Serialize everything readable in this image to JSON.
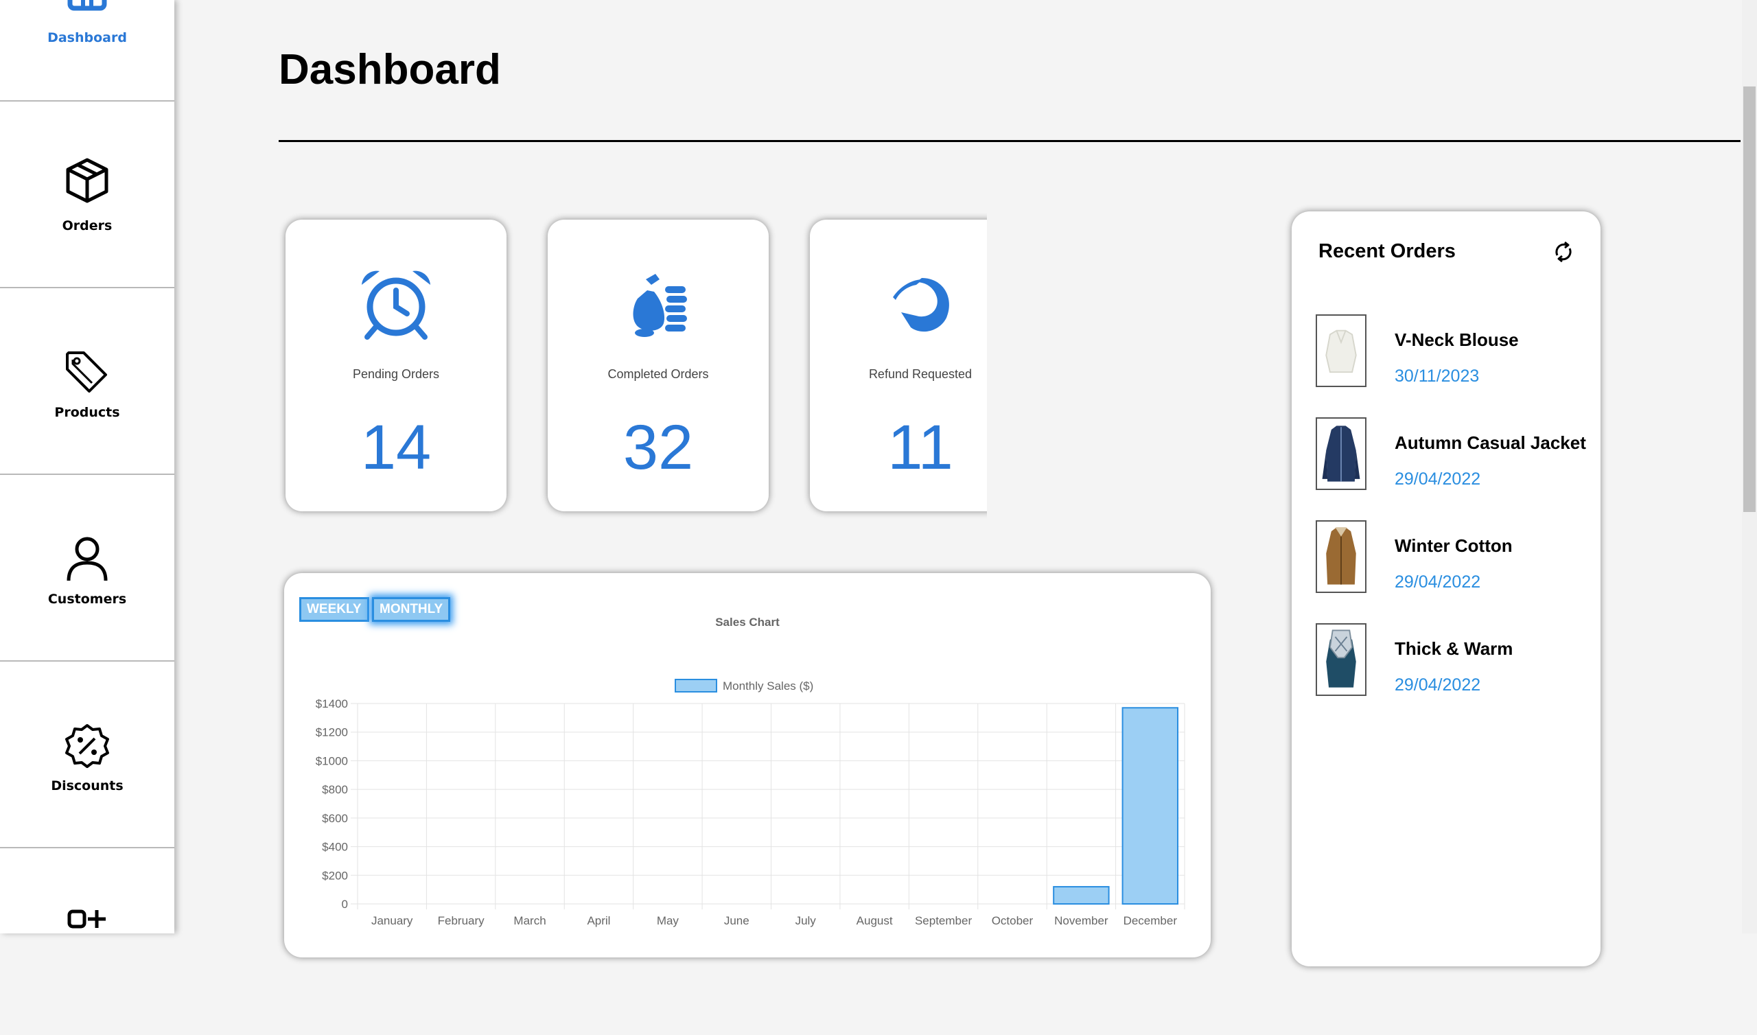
{
  "sidebar": {
    "items": [
      {
        "label": "Dashboard",
        "icon": "home-icon",
        "active": true
      },
      {
        "label": "Orders",
        "icon": "package-icon"
      },
      {
        "label": "Products",
        "icon": "tag-icon"
      },
      {
        "label": "Customers",
        "icon": "user-icon"
      },
      {
        "label": "Discounts",
        "icon": "discount-badge-icon"
      },
      {
        "label": "",
        "icon": "add-shapes-icon"
      }
    ]
  },
  "page": {
    "title": "Dashboard"
  },
  "stats": [
    {
      "label": "Pending Orders",
      "value": "14",
      "icon": "alarm-clock-icon"
    },
    {
      "label": "Completed Orders",
      "value": "32",
      "icon": "money-bag-coins-icon"
    },
    {
      "label": "Refund Requested",
      "value": "11",
      "icon": "refund-arrow-icon"
    }
  ],
  "chart": {
    "tabs": [
      {
        "label": "WEEKLY",
        "active": false
      },
      {
        "label": "MONTHLY",
        "active": true
      }
    ]
  },
  "chart_data": {
    "type": "bar",
    "title": "Sales Chart",
    "categories": [
      "January",
      "February",
      "March",
      "April",
      "May",
      "June",
      "July",
      "August",
      "September",
      "October",
      "November",
      "December"
    ],
    "series": [
      {
        "name": "Monthly Sales ($)",
        "values": [
          0,
          0,
          0,
          0,
          0,
          0,
          0,
          0,
          0,
          0,
          120,
          1370
        ]
      }
    ],
    "yticks": [
      "0",
      "$200",
      "$400",
      "$600",
      "$800",
      "$1000",
      "$1200",
      "$1400"
    ],
    "ylim": [
      0,
      1400
    ],
    "grid": true,
    "legend": "top-center",
    "colors": {
      "fill": "#9ccff4",
      "stroke": "#2a8ee0"
    }
  },
  "recent_orders": {
    "title": "Recent Orders",
    "refresh_icon": "refresh-icon",
    "items": [
      {
        "name": "V-Neck Blouse",
        "date": "30/11/2023",
        "thumb": "white-blouse"
      },
      {
        "name": "Autumn Casual Jacket",
        "date": "29/04/2022",
        "thumb": "navy-jacket"
      },
      {
        "name": "Winter Cotton",
        "date": "29/04/2022",
        "thumb": "brown-coat"
      },
      {
        "name": "Thick & Warm",
        "date": "29/04/2022",
        "thumb": "scarf-jacket"
      }
    ]
  },
  "colors": {
    "accent": "#2a78d6",
    "link": "#2a8ee0"
  }
}
